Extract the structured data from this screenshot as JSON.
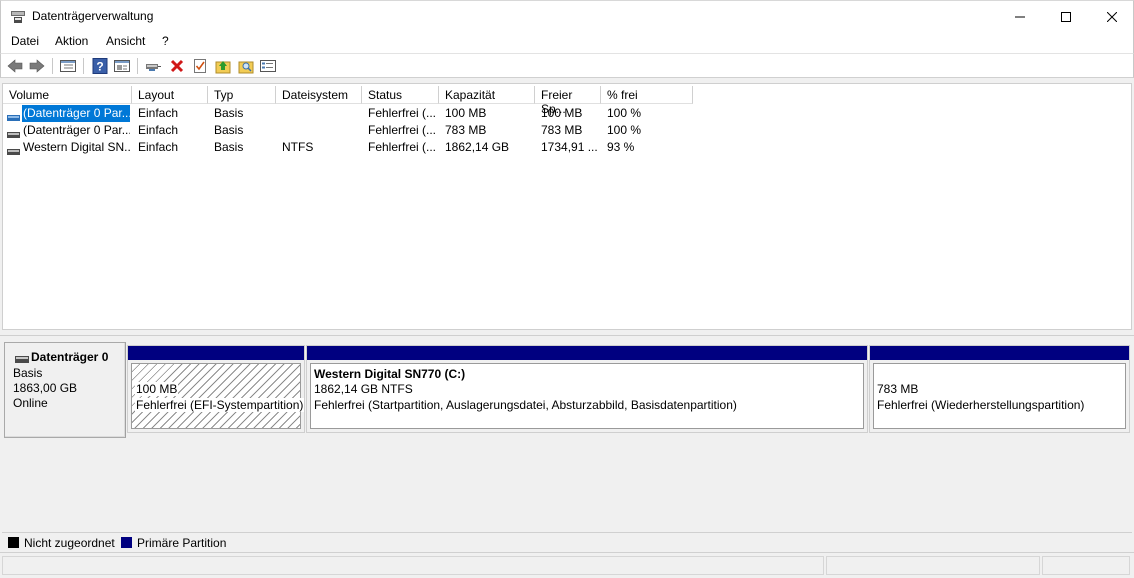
{
  "window": {
    "title": "Datenträgerverwaltung",
    "minimize_icon": "minimize-icon",
    "maximize_icon": "maximize-icon",
    "close_icon": "close-icon"
  },
  "menu": [
    "Datei",
    "Aktion",
    "Ansicht",
    "?"
  ],
  "toolbar": {
    "icons": [
      "back-icon",
      "forward-icon",
      "console-tree-icon",
      "help-icon",
      "properties-pane-icon",
      "connect-disk-icon",
      "delete-icon",
      "check-icon",
      "up-folder-icon",
      "search-folder-icon",
      "settings-list-icon"
    ]
  },
  "volume_list": {
    "columns": [
      "Volume",
      "Layout",
      "Typ",
      "Dateisystem",
      "Status",
      "Kapazität",
      "Freier Sp...",
      "% frei"
    ],
    "rows": [
      {
        "volume": "(Datenträger 0 Par...",
        "layout": "Einfach",
        "typ": "Basis",
        "dateisystem": "",
        "status": "Fehlerfrei (...",
        "kapazitaet": "100 MB",
        "frei": "100 MB",
        "prozent": "100 %"
      },
      {
        "volume": "(Datenträger 0 Par...",
        "layout": "Einfach",
        "typ": "Basis",
        "dateisystem": "",
        "status": "Fehlerfrei (...",
        "kapazitaet": "783 MB",
        "frei": "783 MB",
        "prozent": "100 %"
      },
      {
        "volume": "Western Digital SN...",
        "layout": "Einfach",
        "typ": "Basis",
        "dateisystem": "NTFS",
        "status": "Fehlerfrei (...",
        "kapazitaet": "1862,14 GB",
        "frei": "1734,91 ...",
        "prozent": "93 %"
      }
    ]
  },
  "disk": {
    "name": "Datenträger 0",
    "type": "Basis",
    "size": "1863,00 GB",
    "state": "Online"
  },
  "partitions": [
    {
      "title": "",
      "size": "100 MB",
      "status": "Fehlerfrei (EFI-Systempartition)"
    },
    {
      "title": "Western Digital SN770  (C:)",
      "size": "1862,14 GB NTFS",
      "status": "Fehlerfrei (Startpartition, Auslagerungsdatei, Absturzabbild, Basisdatenpartition)"
    },
    {
      "title": "",
      "size": "783 MB",
      "status": "Fehlerfrei (Wiederherstellungspartition)"
    }
  ],
  "legend": [
    {
      "label": "Nicht zugeordnet",
      "color": "#000000"
    },
    {
      "label": "Primäre Partition",
      "color": "#000080"
    }
  ],
  "colors": {
    "primary_partition": "#000080",
    "unallocated": "#000000",
    "selection": "#0078d7"
  }
}
